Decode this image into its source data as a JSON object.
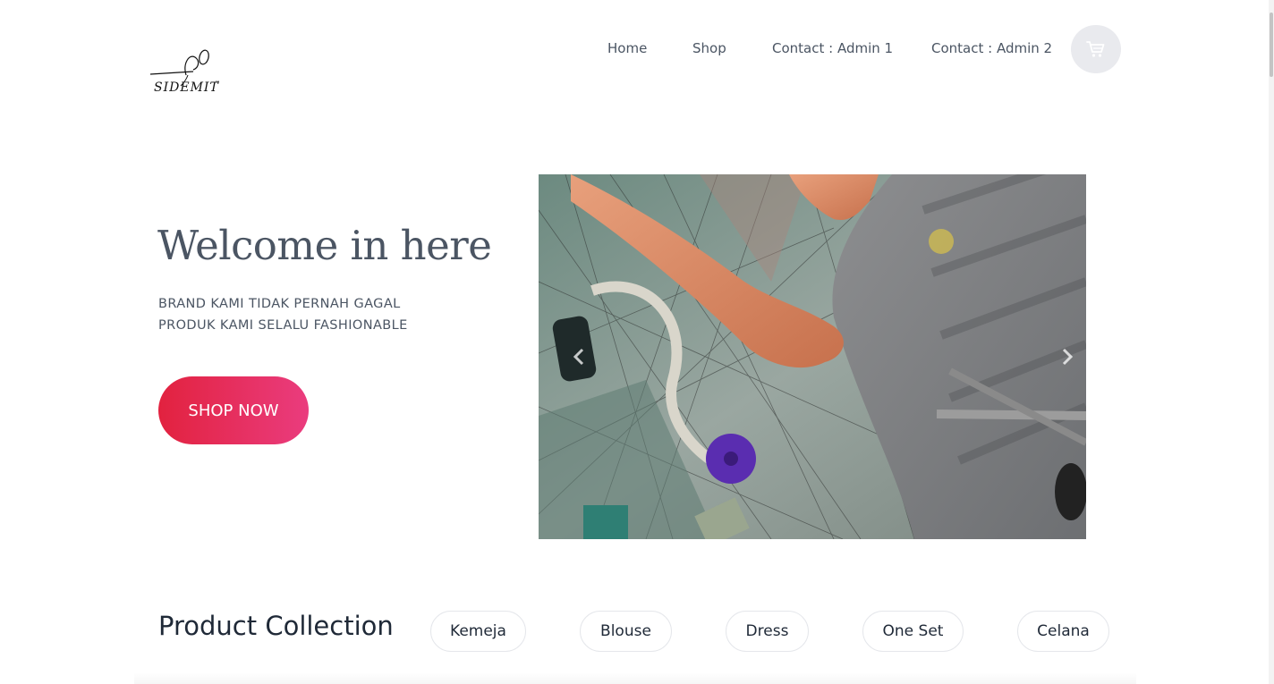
{
  "brand": {
    "name": "SIDEMIT",
    "tm": "™"
  },
  "nav": {
    "items": [
      {
        "label": "Home"
      },
      {
        "label": "Shop"
      },
      {
        "label": "Contact : Admin 1"
      },
      {
        "label": "Contact : Admin 2"
      }
    ],
    "cart_icon": "cart-icon"
  },
  "hero": {
    "title": "Welcome in here",
    "subtitle_line1": "BRAND KAMI TIDAK PERNAH GAGAL",
    "subtitle_line2": "PRODUK KAMI SELALU FASHIONABLE",
    "cta_label": "SHOP NOW",
    "cta_gradient": [
      "#e2223f",
      "#ea3c7e"
    ]
  },
  "carousel": {
    "prev_icon": "chevron-left-icon",
    "next_icon": "chevron-right-icon"
  },
  "collection": {
    "title": "Product Collection",
    "categories": [
      "Kemeja",
      "Blouse",
      "Dress",
      "One Set",
      "Celana"
    ]
  }
}
